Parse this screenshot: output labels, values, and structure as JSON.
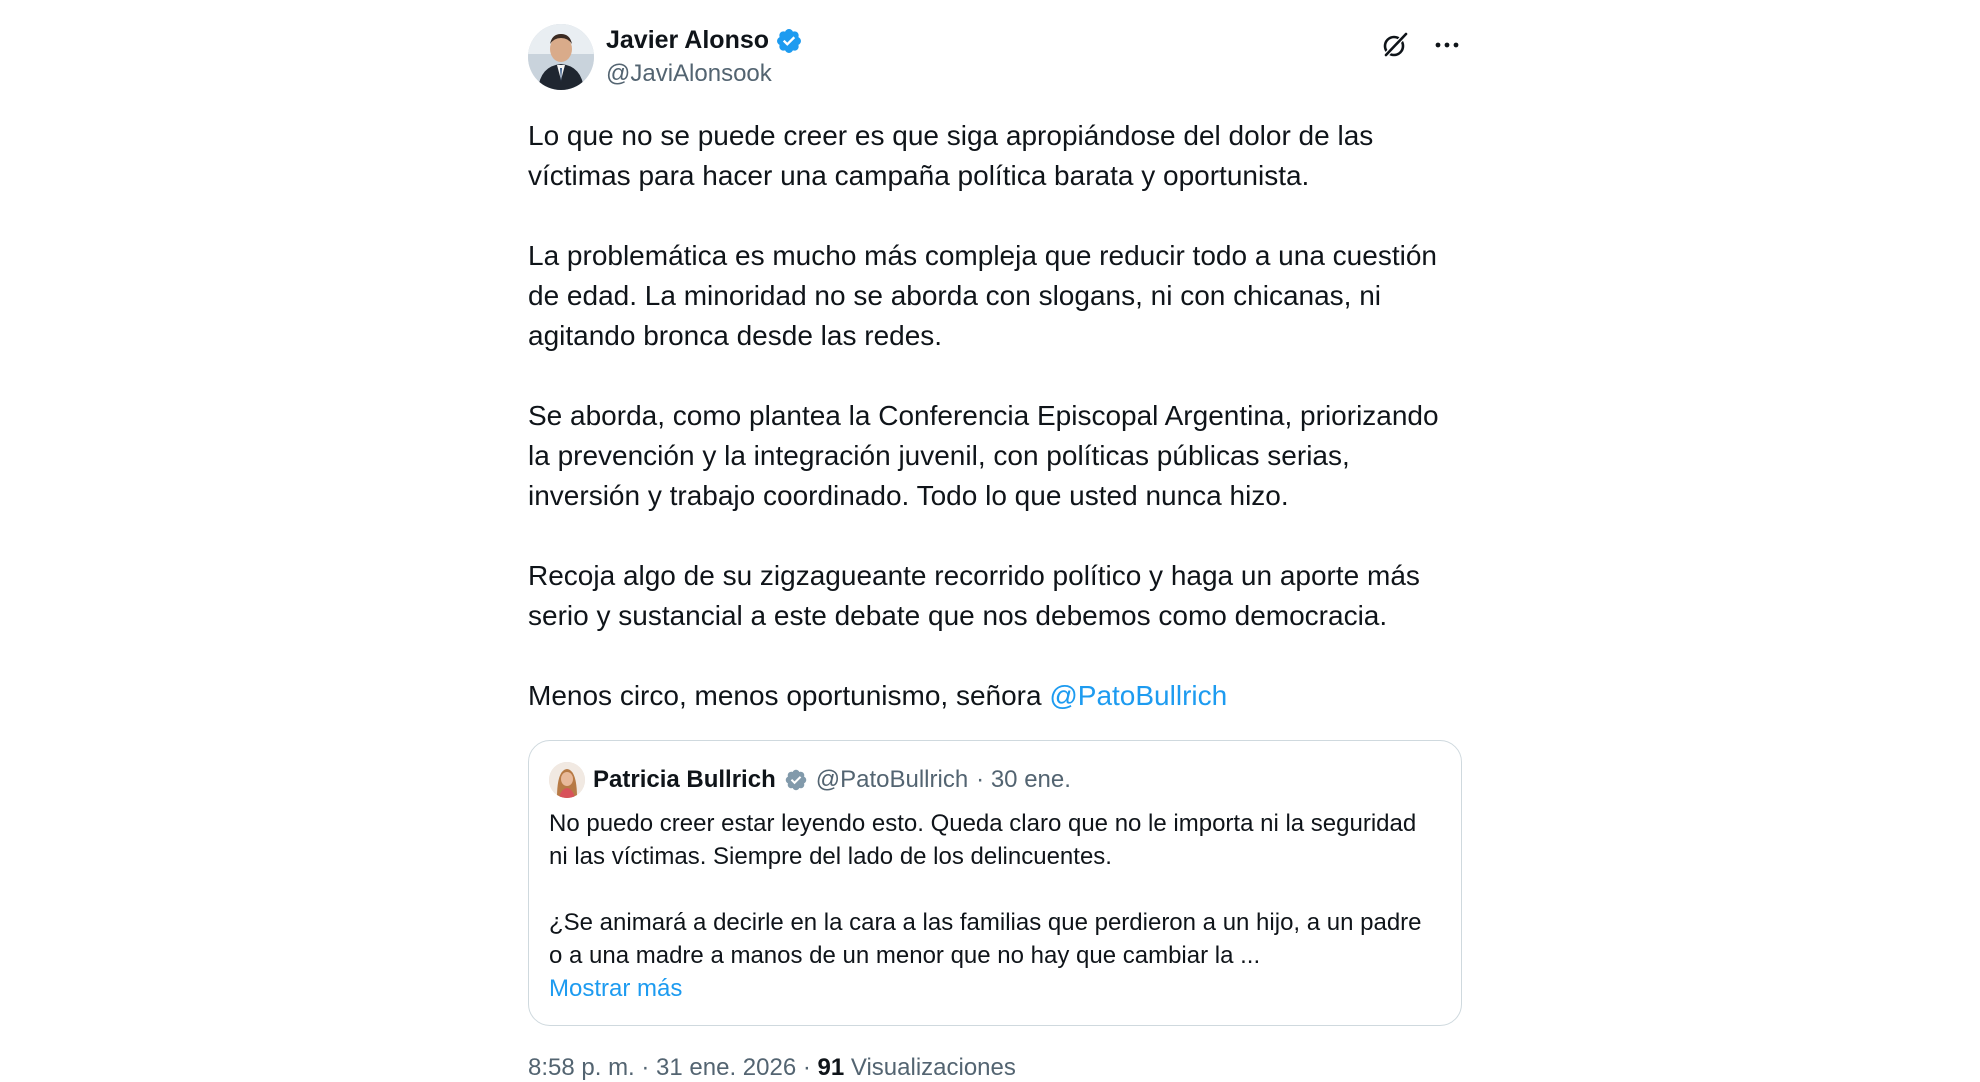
{
  "author": {
    "name": "Javier Alonso",
    "handle": "@JaviAlonsook",
    "verified_color": "#1d9bf0"
  },
  "actions": {
    "grok_icon": "grok-icon",
    "more_icon": "more-icon"
  },
  "body": {
    "paragraphs": [
      "Lo que no se puede creer es que siga apropiándose del dolor de las víctimas para hacer una campaña política barata y oportunista.",
      "La problemática es mucho más compleja que reducir todo a una cuestión de edad. La minoridad no se aborda con slogans, ni con chicanas, ni agitando bronca desde las redes.",
      "Se aborda, como plantea la Conferencia Episcopal Argentina, priorizando la prevención y la integración juvenil, con políticas públicas serias, inversión y trabajo coordinado. Todo lo que usted nunca hizo.",
      "Recoja algo de su zigzagueante recorrido político y haga un aporte más serio y sustancial a este debate que nos debemos como democracia."
    ],
    "last_prefix": "Menos circo, menos oportunismo, señora ",
    "last_mention": "@PatoBullrich"
  },
  "quote": {
    "name": "Patricia Bullrich",
    "handle": "@PatoBullrich",
    "date": "· 30 ene.",
    "verified_color": "#829aab",
    "paragraphs": [
      "No puedo creer estar leyendo esto. Queda claro que no le importa ni la seguridad ni las víctimas. Siempre del lado de los delincuentes.",
      "¿Se animará a decirle en la cara a las familias que perdieron a un hijo, a un padre o a una madre a manos de un menor que no hay que cambiar la ..."
    ],
    "show_more": "Mostrar más"
  },
  "meta": {
    "time": "8:58 p. m. · 31 ene. 2026 · ",
    "views_count": "91",
    "views_label": " Visualizaciones"
  }
}
